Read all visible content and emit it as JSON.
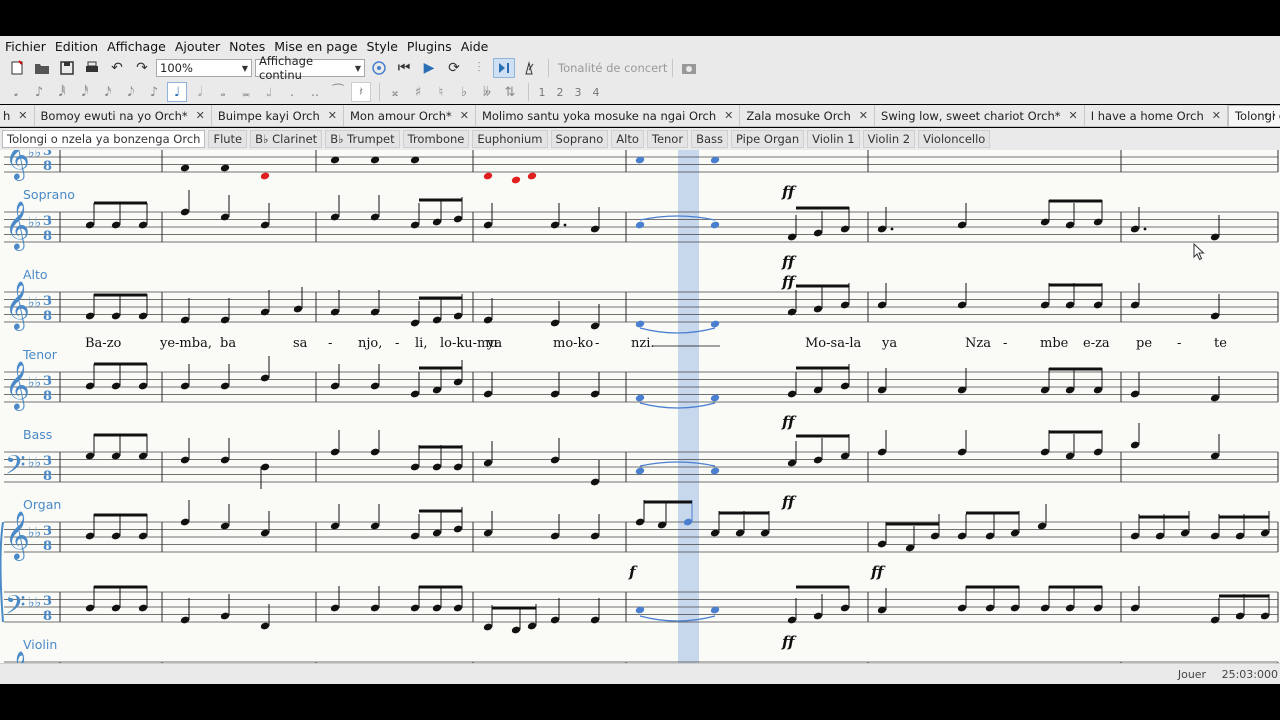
{
  "menu": [
    "Fichier",
    "Edition",
    "Affichage",
    "Ajouter",
    "Notes",
    "Mise en page",
    "Style",
    "Plugins",
    "Aide"
  ],
  "toolbar": {
    "zoom": "100%",
    "view_mode": "Affichage continu",
    "concert_pitch": "Tonalité de concert"
  },
  "note_input": {
    "voices": [
      "1",
      "2",
      "3",
      "4"
    ]
  },
  "score_tabs": [
    {
      "label": "h",
      "closable": true
    },
    {
      "label": "Bomoy ewuti na yo Orch*",
      "closable": true
    },
    {
      "label": "Buimpe kayi Orch",
      "closable": true
    },
    {
      "label": "Mon amour Orch*",
      "closable": true
    },
    {
      "label": "Molimo santu yoka mosuke na ngai Orch",
      "closable": true
    },
    {
      "label": "Zala mosuke Orch",
      "closable": true
    },
    {
      "label": "Swing low, sweet chariot Orch*",
      "closable": true
    },
    {
      "label": "I have a home Orch",
      "closable": true
    },
    {
      "label": "Tolongi o nzela ya bonzenga Orch",
      "closable": true,
      "active": true
    }
  ],
  "part_tabs": [
    "Tolongi o nzela ya bonzenga Orch",
    "Flute",
    "B♭ Clarinet",
    "B♭ Trumpet",
    "Trombone",
    "Euphonium",
    "Soprano",
    "Alto",
    "Tenor",
    "Bass",
    "Pipe Organ",
    "Violin 1",
    "Violin 2",
    "Violoncello"
  ],
  "staves": {
    "soprano": "Soprano",
    "alto": "Alto",
    "tenor": "Tenor",
    "bass": "Bass",
    "organ": "Organ",
    "violin": "Violin"
  },
  "lyrics": [
    "Ba-zo",
    "ye-mba,",
    "ba",
    "sa",
    "-",
    "njo,",
    "-",
    "li,",
    "lo-ku-mu",
    "ya",
    "mo-ko",
    "-",
    "nzi.",
    "Mo-sa-la",
    "ya",
    "Nza",
    "-",
    "mbe",
    "e-za",
    "pe",
    "-",
    "te"
  ],
  "dynamics": {
    "ff": "ff",
    "f": "f"
  },
  "status": {
    "state": "Jouer",
    "time": "25:03:000"
  },
  "colors": {
    "selection": "#4a7fd0",
    "playhead": "#9dbbe6",
    "highlight_note": "#e02020"
  }
}
